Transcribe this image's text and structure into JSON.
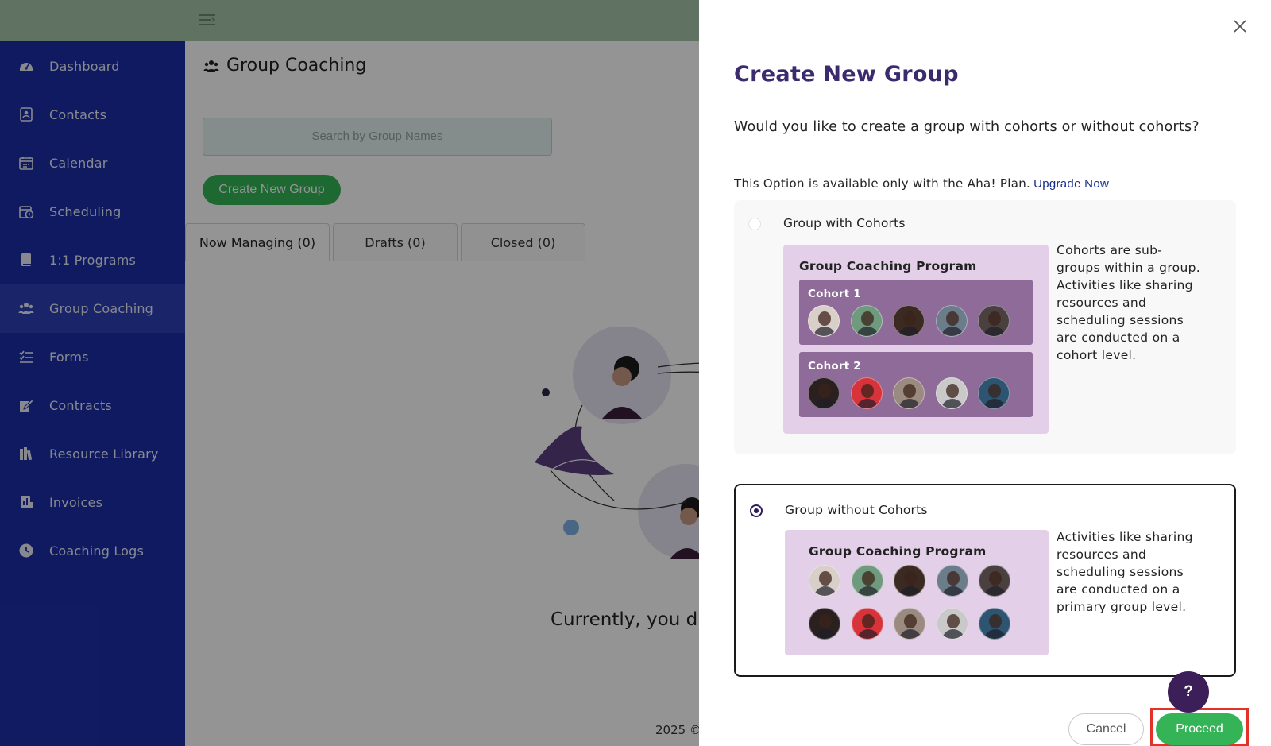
{
  "sidebar": {
    "items": [
      {
        "label": "Dashboard",
        "icon": "dashboard-icon"
      },
      {
        "label": "Contacts",
        "icon": "contacts-icon"
      },
      {
        "label": "Calendar",
        "icon": "calendar-icon"
      },
      {
        "label": "Scheduling",
        "icon": "scheduling-icon"
      },
      {
        "label": "1:1 Programs",
        "icon": "book-icon"
      },
      {
        "label": "Group Coaching",
        "icon": "group-icon",
        "active": true
      },
      {
        "label": "Forms",
        "icon": "checklist-icon"
      },
      {
        "label": "Contracts",
        "icon": "signature-icon"
      },
      {
        "label": "Resource Library",
        "icon": "library-icon"
      },
      {
        "label": "Invoices",
        "icon": "invoice-icon"
      },
      {
        "label": "Coaching Logs",
        "icon": "clock-icon"
      }
    ]
  },
  "main": {
    "title": "Group Coaching",
    "search_placeholder": "Search by Group Names",
    "create_button": "Create New Group",
    "tabs": [
      {
        "label": "Now Managing (0)",
        "active": true
      },
      {
        "label": "Drafts (0)"
      },
      {
        "label": "Closed (0)"
      }
    ],
    "empty_text": "Currently, you d",
    "footer_text": "2025 ©"
  },
  "modal": {
    "title": "Create New Group",
    "question": "Would you like to create a group with cohorts or without cohorts?",
    "note": "This Option is available only with the Aha! Plan.",
    "upgrade_link": "Upgrade Now",
    "options": [
      {
        "label": "Group with Cohorts",
        "selected": false,
        "program_title": "Group Coaching Program",
        "cohorts": [
          "Cohort 1",
          "Cohort 2"
        ],
        "description": "Cohorts are sub-groups within a group. Activities like sharing resources and scheduling sessions are conducted on a cohort level."
      },
      {
        "label": "Group without Cohorts",
        "selected": true,
        "program_title": "Group Coaching Program",
        "description": "Activities like sharing resources and scheduling sessions are conducted on a primary group level."
      }
    ],
    "help_label": "?",
    "cancel_label": "Cancel",
    "proceed_label": "Proceed"
  },
  "colors": {
    "sidebar": "#1d2ea8",
    "topbar": "#a5c6a9",
    "primary_green": "#35b457",
    "modal_title": "#3b2a6e",
    "cohort_card": "#8e6b98",
    "program_card": "#e3d0e8",
    "highlight_box": "#e33228"
  },
  "avatar_colors": {
    "row1": [
      "#d9cfc9",
      "#6f9a7d",
      "#3a2a22",
      "#6b7c8a",
      "#4a4040"
    ],
    "row2": [
      "#2b2020",
      "#d8323a",
      "#9a8a80",
      "#c9c9c9",
      "#2d5470"
    ]
  }
}
